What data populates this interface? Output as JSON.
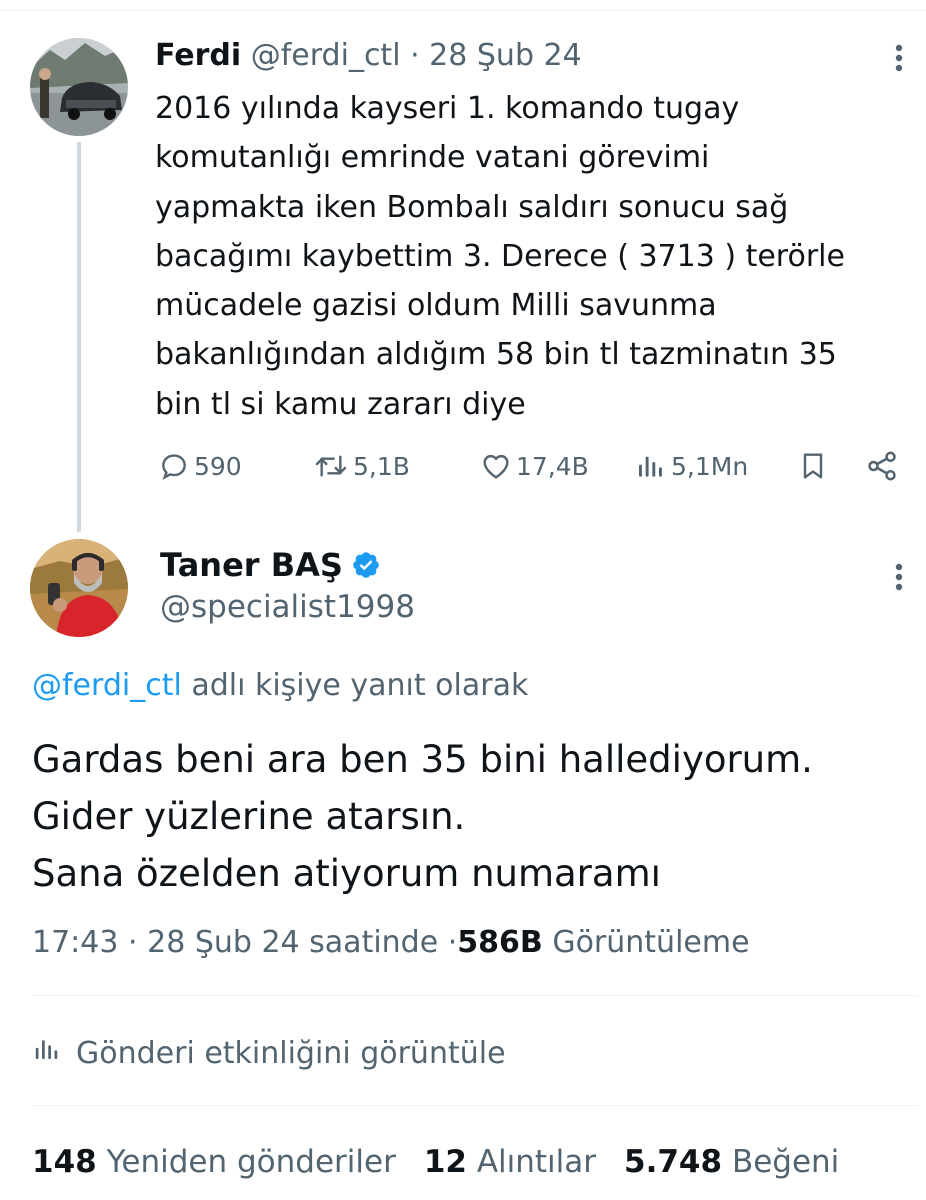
{
  "parent_tweet": {
    "author_name": "Ferdi",
    "author_handle": "@ferdi_ctl",
    "separator": "·",
    "date": "28 Şub 24",
    "text": "2016 yılında kayseri 1. komando tugay\nkomutanlığı emrinde vatani görevimi\nyapmakta iken  Bombalı saldırı sonucu sağ\nbacağımı kaybettim  3. Derece ( 3713 )  terörle\nmücadele gazisi oldum Milli savunma\nbakanlığından aldığım 58 bin tl tazminatın 35\nbin tl si kamu zararı diye",
    "actions": {
      "replies": "590",
      "reposts": "5,1B",
      "likes": "17,4B",
      "views": "5,1Mn"
    },
    "icons": [
      "reply-icon",
      "repost-icon",
      "like-icon",
      "views-icon",
      "bookmark-icon",
      "share-icon",
      "more-icon"
    ]
  },
  "reply_tweet": {
    "author_name": "Taner BAŞ",
    "author_handle": "@specialist1998",
    "verified": true,
    "replying_to_handle": "@ferdi_ctl",
    "replying_to_suffix": " adlı kişiye yanıt olarak",
    "text": "Gardas beni ara ben 35 bini hallediyorum.\nGider yüzlerine atarsın.\nSana özelden atiyorum numaramı",
    "time": "17:43",
    "separator": "·",
    "date_text": "28 Şub 24 saatinde",
    "views_count": "586B",
    "views_label": "Görüntüleme",
    "activity_label": "Gönderi etkinliğini görüntüle",
    "stats": {
      "reposts_count": "148",
      "reposts_label": "Yeniden gönderiler",
      "quotes_count": "12",
      "quotes_label": "Alıntılar",
      "likes_count": "5.748",
      "likes_label": "Beğeni"
    }
  },
  "colors": {
    "text": "#0f1419",
    "secondary": "#536471",
    "link": "#1d9bf0",
    "verified": "#1d9bf0",
    "divider": "#eff3f4",
    "thread_line": "#cfd9de"
  }
}
